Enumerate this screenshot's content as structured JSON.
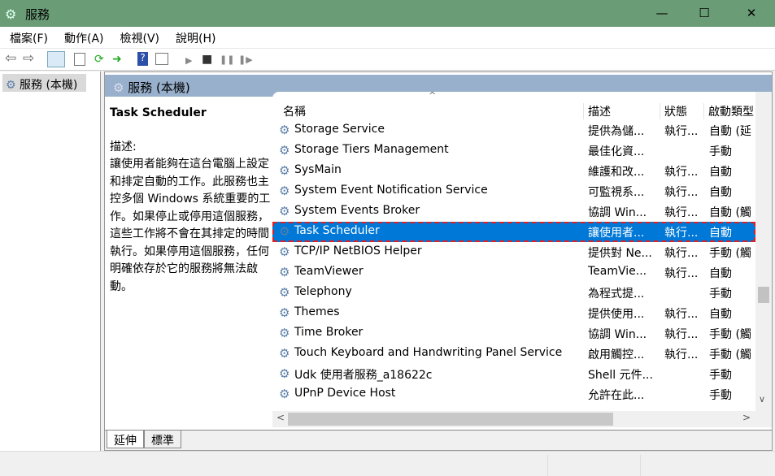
{
  "window": {
    "title": "服務",
    "minimize": "—",
    "maximize": "☐",
    "close": "✕"
  },
  "menu": [
    "檔案(F)",
    "動作(A)",
    "檢視(V)",
    "說明(H)"
  ],
  "toolbar": {
    "back": "⇦",
    "forward": "⇨",
    "start": "▶",
    "stop": "■",
    "pause": "❚❚",
    "resume": "❚▶"
  },
  "tree": {
    "item": "服務 (本機)"
  },
  "panel": {
    "title": "服務 (本機)"
  },
  "description": {
    "service": "Task Scheduler",
    "label": "描述:",
    "text": "讓使用者能夠在這台電腦上設定和排定自動的工作。此服務也主控多個 Windows 系統重要的工作。如果停止或停用這個服務，這些工作將不會在其排定的時間執行。如果停用這個服務，任何明確依存於它的服務將無法啟動。"
  },
  "columns": [
    "名稱",
    "描述",
    "狀態",
    "啟動類型"
  ],
  "rows": [
    {
      "name": "Storage Service",
      "desc": "提供為儲...",
      "status": "執行...",
      "startup": "自動 (延"
    },
    {
      "name": "Storage Tiers Management",
      "desc": "最佳化資...",
      "status": "",
      "startup": "手動"
    },
    {
      "name": "SysMain",
      "desc": "維護和改...",
      "status": "執行...",
      "startup": "自動"
    },
    {
      "name": "System Event Notification Service",
      "desc": "可監視系...",
      "status": "執行...",
      "startup": "自動"
    },
    {
      "name": "System Events Broker",
      "desc": "協調 Win...",
      "status": "執行...",
      "startup": "自動 (觸"
    },
    {
      "name": "Task Scheduler",
      "desc": "讓使用者...",
      "status": "執行...",
      "startup": "自動"
    },
    {
      "name": "TCP/IP NetBIOS Helper",
      "desc": "提供對 Ne...",
      "status": "執行...",
      "startup": "手動 (觸"
    },
    {
      "name": "TeamViewer",
      "desc": "TeamVie...",
      "status": "執行...",
      "startup": "自動"
    },
    {
      "name": "Telephony",
      "desc": "為程式提...",
      "status": "",
      "startup": "手動"
    },
    {
      "name": "Themes",
      "desc": "提供使用...",
      "status": "執行...",
      "startup": "自動"
    },
    {
      "name": "Time Broker",
      "desc": "協調 Win...",
      "status": "執行...",
      "startup": "手動 (觸"
    },
    {
      "name": "Touch Keyboard and Handwriting Panel Service",
      "desc": "啟用觸控...",
      "status": "執行...",
      "startup": "手動 (觸"
    },
    {
      "name": "Udk 使用者服務_a18622c",
      "desc": "Shell 元件...",
      "status": "",
      "startup": "手動"
    },
    {
      "name": "UPnP Device Host",
      "desc": "允許在此...",
      "status": "",
      "startup": "手動"
    }
  ],
  "selected_index": 5,
  "tabs": [
    "延伸",
    "標準"
  ]
}
